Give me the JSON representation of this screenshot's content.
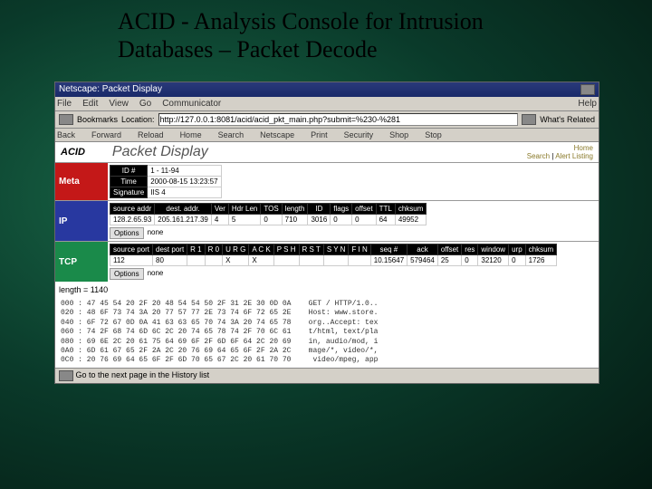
{
  "title_line1": "ACID - Analysis Console for Intrusion",
  "title_line2": "Databases – Packet Decode",
  "window": {
    "title": "Netscape: Packet Display",
    "menu": [
      "File",
      "Edit",
      "View",
      "Go",
      "Communicator"
    ],
    "menu_help": "Help",
    "bookmarks": "Bookmarks",
    "location": "Location:",
    "url": "http://127.0.0.1:8081/acid/acid_pkt_main.php?submit=%230-%281",
    "related": "What's Related",
    "nav": [
      "Back",
      "Forward",
      "Reload",
      "Home",
      "Search",
      "Netscape",
      "Print",
      "Security",
      "Shop",
      "Stop"
    ],
    "status": "Go to the next page in the History list"
  },
  "page": {
    "acid": "ACID",
    "heading": "Packet Display",
    "links": {
      "home": "Home",
      "search": "Search",
      "alert": "Alert Listing"
    }
  },
  "meta": {
    "label": "Meta",
    "headers": [
      "ID #",
      "Time",
      "Signature"
    ],
    "values": [
      "1 - 11-94",
      "2000-08-15 13:23:57",
      "IIS 4"
    ]
  },
  "ip": {
    "label": "IP",
    "headers": [
      "source addr",
      "dest. addr.",
      "Ver",
      "Hdr Len",
      "TOS",
      "length",
      "ID",
      "flags",
      "offset",
      "TTL",
      "chksum"
    ],
    "values": [
      "128.2.65.93",
      "205.161.217.39",
      "4",
      "5",
      "0",
      "710",
      "3016",
      "0",
      "0",
      "64",
      "49952"
    ],
    "options_label": "Options",
    "options_val": "none"
  },
  "tcp": {
    "label": "TCP",
    "headers": [
      "source port",
      "dest port",
      "R 1",
      "R 0",
      "U R G",
      "A C K",
      "P S H",
      "R S T",
      "S Y N",
      "F I N",
      "seq #",
      "ack",
      "offset",
      "res",
      "window",
      "urp",
      "chksum"
    ],
    "values": [
      "112",
      "80",
      "",
      "",
      "X",
      "X",
      "",
      "",
      "",
      "",
      "10.15647",
      "579464",
      "25",
      "0",
      "32120",
      "0",
      "1726"
    ],
    "options_label": "Options",
    "options_val": "none"
  },
  "payload": {
    "length": "length = 1140",
    "rows": [
      "000 : 47 45 54 20 2F 20 48 54 54 50 2F 31 2E 30 0D 0A    GET / HTTP/1.0..",
      "020 : 48 6F 73 74 3A 20 77 57 77 2E 73 74 6F 72 65 2E    Host: www.store.",
      "040 : 6F 72 67 0D 0A 41 63 63 65 70 74 3A 20 74 65 78    org..Accept: tex",
      "060 : 74 2F 68 74 6D 6C 2C 20 74 65 78 74 2F 70 6C 61    t/html, text/pla",
      "080 : 69 6E 2C 20 61 75 64 69 6F 2F 6D 6F 64 2C 20 69    in, audio/mod, i",
      "0A0 : 6D 61 67 65 2F 2A 2C 20 76 69 64 65 6F 2F 2A 2C    mage/*, video/*,",
      "0C0 : 20 76 69 64 65 6F 2F 6D 70 65 67 2C 20 61 70 70     video/mpeg, app"
    ]
  }
}
